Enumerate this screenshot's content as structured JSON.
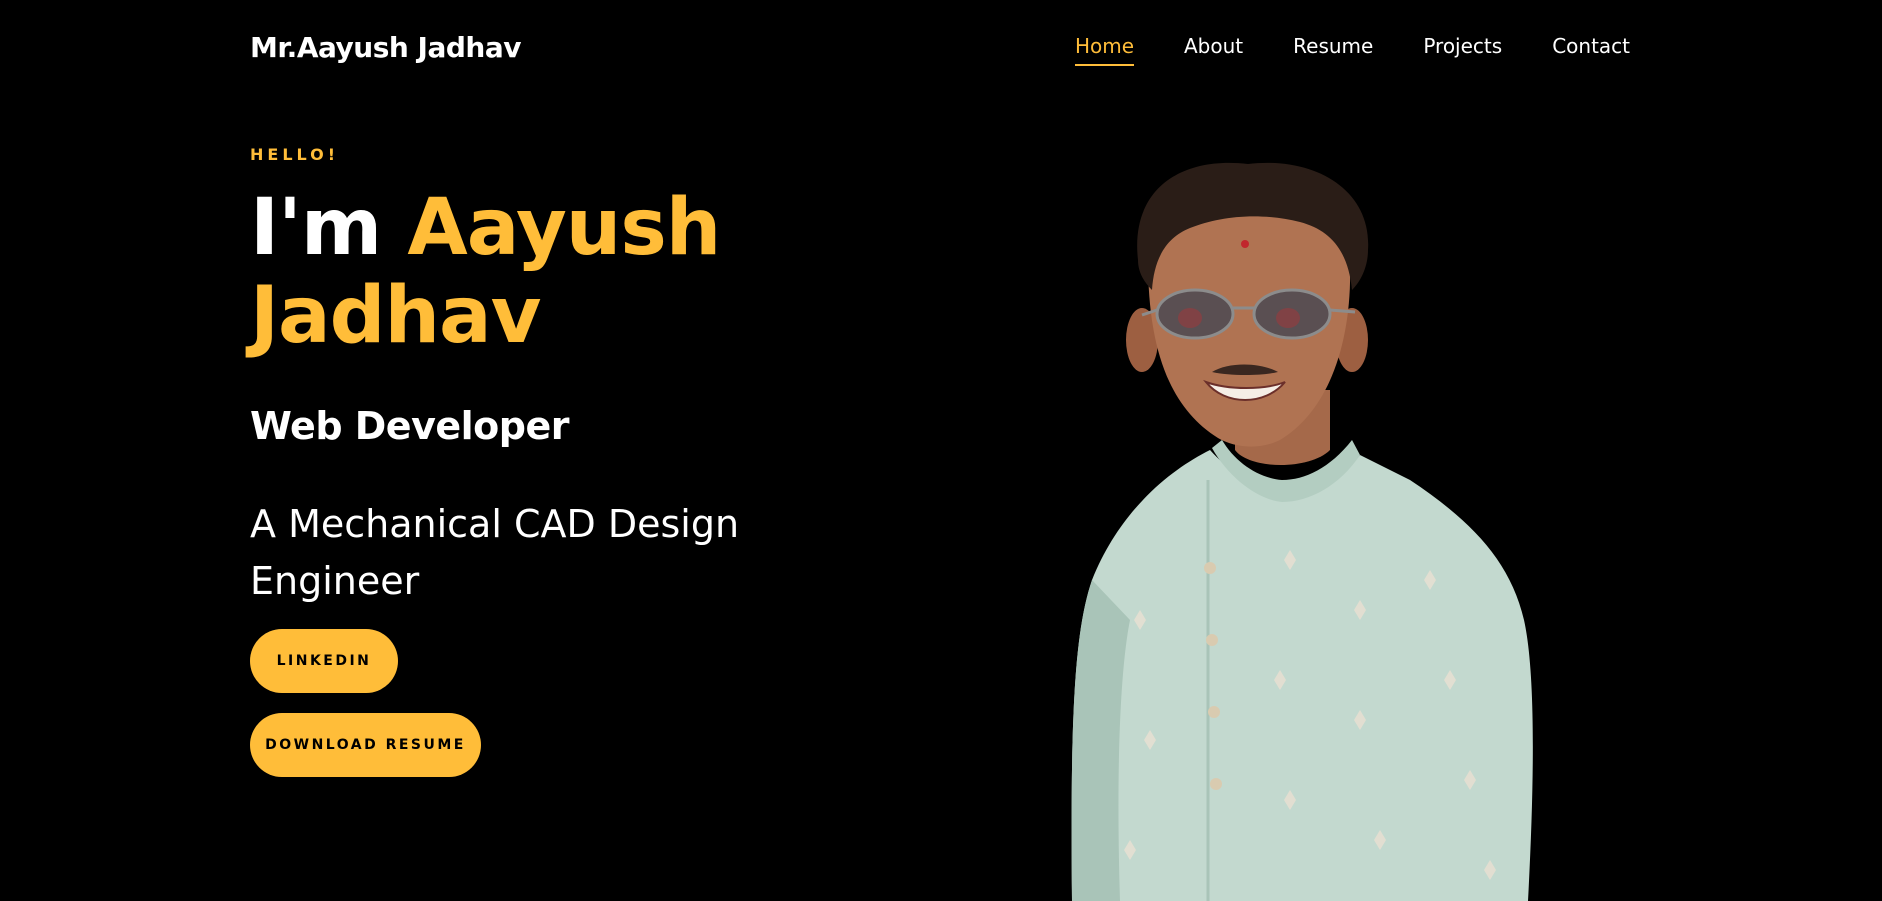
{
  "nav": {
    "brand": "Mr.Aayush Jadhav",
    "items": [
      {
        "label": "Home",
        "active": true
      },
      {
        "label": "About",
        "active": false
      },
      {
        "label": "Resume",
        "active": false
      },
      {
        "label": "Projects",
        "active": false
      },
      {
        "label": "Contact",
        "active": false
      }
    ]
  },
  "hero": {
    "greeting": "HELLO!",
    "im": "I'm",
    "first_name": "Aayush",
    "last_name": "Jadhav",
    "role": "Web Developer",
    "tagline": "A Mechanical CAD Design Engineer",
    "linkedin_label": "LINKEDIN",
    "resume_label": "DOWNLOAD RESUME"
  },
  "colors": {
    "accent": "#ffbd39",
    "background": "#000000",
    "text": "#ffffff"
  }
}
